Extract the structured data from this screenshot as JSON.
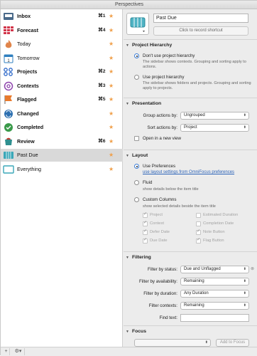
{
  "window": {
    "title": "Perspectives"
  },
  "sidebar": {
    "items": [
      {
        "label": "Inbox",
        "bold": true,
        "shortcut": "⌘1",
        "icon": "inbox-icon",
        "color": "#4a6a8a"
      },
      {
        "label": "Forecast",
        "bold": true,
        "shortcut": "⌘4",
        "icon": "forecast-icon",
        "color": "#d2354a"
      },
      {
        "label": "Today",
        "bold": false,
        "shortcut": "",
        "icon": "flame-icon",
        "color": "#e0844a"
      },
      {
        "label": "Tomorrow",
        "bold": false,
        "shortcut": "",
        "icon": "calendar-icon",
        "color": "#2f7fbf"
      },
      {
        "label": "Projects",
        "bold": true,
        "shortcut": "⌘2",
        "icon": "projects-icon",
        "color": "#2a66c8"
      },
      {
        "label": "Contexts",
        "bold": true,
        "shortcut": "⌘3",
        "icon": "contexts-icon",
        "color": "#8e44ad"
      },
      {
        "label": "Flagged",
        "bold": true,
        "shortcut": "⌘5",
        "icon": "flag-icon",
        "color": "#e87a2d"
      },
      {
        "label": "Changed",
        "bold": true,
        "shortcut": "",
        "icon": "changed-icon",
        "color": "#2c6fb0"
      },
      {
        "label": "Completed",
        "bold": true,
        "shortcut": "",
        "icon": "completed-icon",
        "color": "#3a9a4a"
      },
      {
        "label": "Review",
        "bold": true,
        "shortcut": "⌘6",
        "icon": "review-icon",
        "color": "#c0392b"
      },
      {
        "label": "Past Due",
        "bold": false,
        "shortcut": "",
        "icon": "past-due-icon",
        "color": "#3aa7b8",
        "selected": true
      },
      {
        "label": "Everything",
        "bold": false,
        "shortcut": "",
        "icon": "everything-icon",
        "color": "#3aa7b8"
      }
    ],
    "star_glyph": "★",
    "bottom": {
      "add": "+",
      "gear": "⚙▾"
    }
  },
  "detail": {
    "name_value": "Past Due",
    "shortcut_button": "Click to record shortcut",
    "project_hierarchy": {
      "title": "Project Hierarchy",
      "option1": "Don't use project hierarchy",
      "option1_desc": "The sidebar shows contexts. Grouping and sorting apply to actions.",
      "option2": "Use project hierarchy",
      "option2_desc": "The sidebar shows folders and projects. Grouping and sorting apply to projects."
    },
    "presentation": {
      "title": "Presentation",
      "group_label": "Group actions by:",
      "group_value": "Ungrouped",
      "sort_label": "Sort actions by:",
      "sort_value": "Project",
      "open_new": "Open in a new view"
    },
    "layout": {
      "title": "Layout",
      "use_prefs": "Use Preferences",
      "use_prefs_link": "use layout settings from OmniFocus preferences",
      "fluid": "Fluid",
      "fluid_desc": "show details below the item title",
      "custom": "Custom Columns",
      "custom_desc": "show selected details beside the item title",
      "columns_left": [
        "Project",
        "Context",
        "Defer Date",
        "Due Date"
      ],
      "columns_right": [
        "Estimated Duration",
        "Completion Date",
        "Note Button",
        "Flag Button"
      ],
      "checked_left": [
        true,
        true,
        true,
        true
      ],
      "checked_right": [
        false,
        false,
        true,
        true
      ]
    },
    "filtering": {
      "title": "Filtering",
      "status_label": "Filter by status:",
      "status_value": "Due and Unflagged",
      "availability_label": "Filter by availability:",
      "availability_value": "Remaining",
      "duration_label": "Filter by duration:",
      "duration_value": "Any Duration",
      "contexts_label": "Filter contexts:",
      "contexts_value": "Remaining",
      "find_label": "Find text:",
      "find_value": ""
    },
    "focus": {
      "title": "Focus",
      "add_button": "Add to Focus"
    }
  },
  "colors": {
    "star": "#f0a04b",
    "selection": "#d9d9d9",
    "link": "#2a62b8"
  }
}
